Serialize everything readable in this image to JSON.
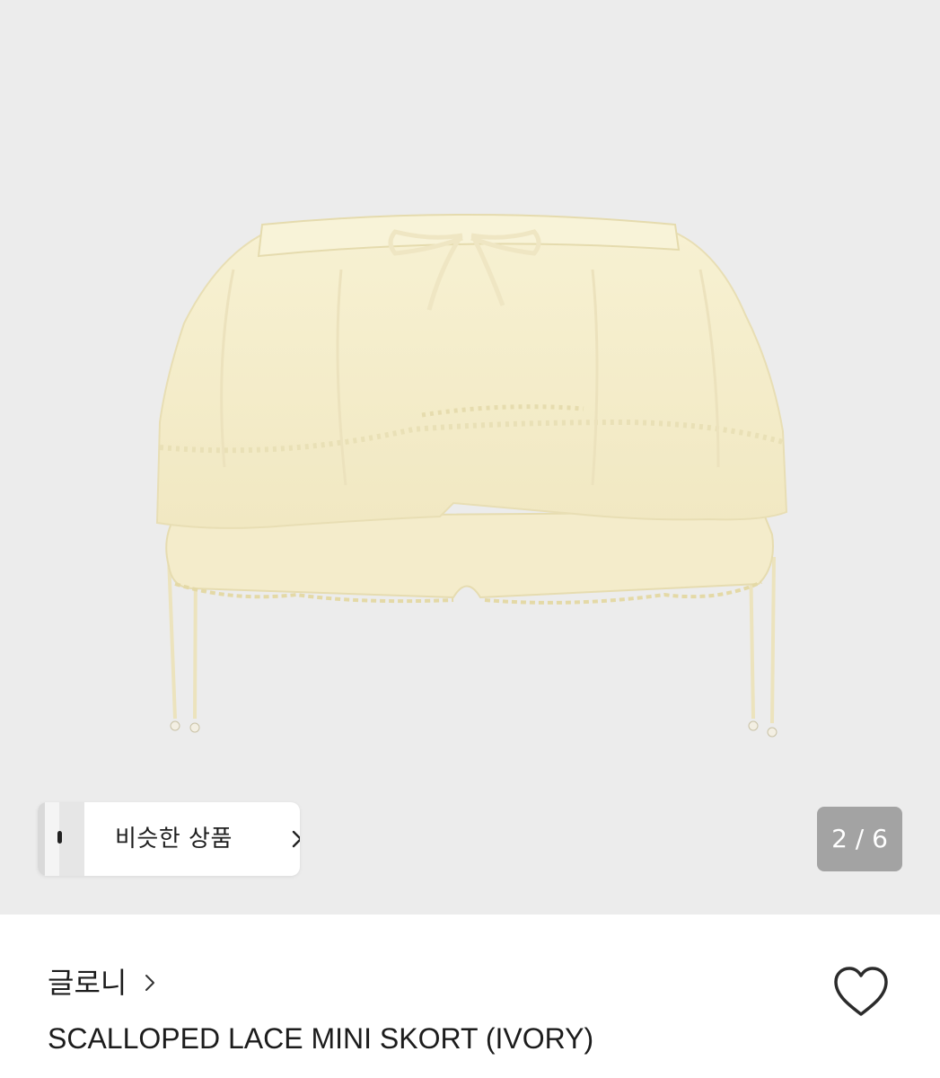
{
  "gallery": {
    "product_image": "lace-mini-skort-photo",
    "similar_products_label": "비슷한 상품",
    "page_counter": "2 / 6",
    "current_page": 2,
    "total_pages": 6
  },
  "product": {
    "brand": "글로니",
    "name": "SCALLOPED LACE MINI SKORT (IVORY)",
    "liked": false
  },
  "icons": {
    "similar_chevron": "chevron-right-icon",
    "brand_chevron": "chevron-right-icon",
    "like": "heart-outline-icon"
  },
  "colors": {
    "gallery_background": "#ececec",
    "garment": "#f6f0cf",
    "counter_background": "#a3a3a3",
    "text": "#1c1c1c"
  }
}
